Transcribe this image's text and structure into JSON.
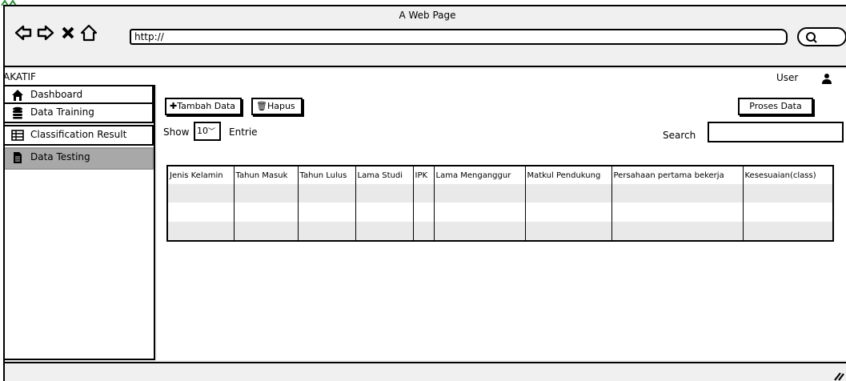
{
  "browser": {
    "title": "A Web Page",
    "url": "http://",
    "nav_icons": [
      "back-arrow-icon",
      "forward-arrow-icon",
      "close-icon",
      "home-icon"
    ]
  },
  "app": {
    "title": "AKATIF",
    "user_label": "User"
  },
  "sidebar": {
    "items": [
      {
        "label": "Dashboard",
        "icon": "home-icon",
        "active": false
      },
      {
        "label": "Data Training",
        "icon": "database-icon",
        "active": false
      },
      {
        "label": "Classification Result",
        "icon": "table-icon",
        "active": false
      },
      {
        "label": "Data Testing",
        "icon": "file-icon",
        "active": true
      }
    ]
  },
  "toolbar": {
    "add_label": "Tambah Data",
    "delete_label": "Hapus",
    "process_label": "Proses Data"
  },
  "listing": {
    "show_label": "Show",
    "page_size": "10",
    "entries_label": "Entrie",
    "search_label": "Search"
  },
  "table": {
    "headers": [
      "Jenis Kelamin",
      "Tahun Masuk",
      "Tahun Lulus",
      "Lama Studi",
      "IPK",
      "Lama Menganggur",
      "Matkul Pendukung",
      "Persahaan pertama bekerja",
      "Kesesuaian(class)"
    ]
  }
}
